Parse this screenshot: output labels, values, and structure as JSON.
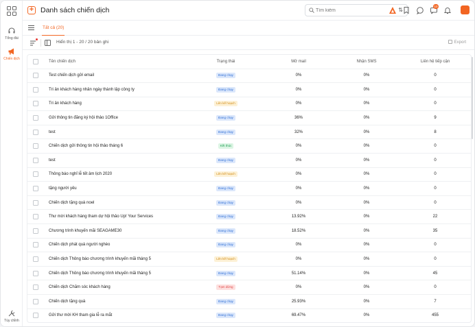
{
  "rail": {
    "items": [
      {
        "label": "Tổng đài",
        "icon": "headset-icon"
      },
      {
        "label": "Chiến dịch",
        "icon": "megaphone-icon",
        "active": true
      },
      {
        "label": "Tùy chỉnh",
        "icon": "tools-icon"
      }
    ]
  },
  "header": {
    "title": "Danh sách chiến dịch",
    "search_placeholder": "Tìm kiếm",
    "notification_count": "10"
  },
  "tabs": [
    {
      "label": "Tất cả (20)",
      "active": true
    }
  ],
  "toolbar": {
    "showing": "Hiển thị 1 - 20 / 20 bản ghi",
    "export_label": "Export"
  },
  "table": {
    "columns": [
      "Tên chiến dịch",
      "Trạng thái",
      "Mở mail",
      "Nhận SMS",
      "Liên hệ tiếp cận"
    ],
    "rows": [
      {
        "name": "Test chiến dịch gửi email",
        "status": "Đang chạy",
        "status_type": "running",
        "open": "0%",
        "sms": "0%",
        "contact": "0"
      },
      {
        "name": "Tri ân khách hàng nhân ngày thành lập công ty",
        "status": "Đang chạy",
        "status_type": "running",
        "open": "0%",
        "sms": "0%",
        "contact": "0"
      },
      {
        "name": "Tri ân khách hàng",
        "status": "Lên kế hoạch",
        "status_type": "planned",
        "open": "0%",
        "sms": "0%",
        "contact": "0"
      },
      {
        "name": "Gửi thông tin đăng ký hội thảo 1Office",
        "status": "Đang chạy",
        "status_type": "running",
        "open": "36%",
        "sms": "0%",
        "contact": "9"
      },
      {
        "name": "test",
        "status": "Đang chạy",
        "status_type": "running",
        "open": "32%",
        "sms": "0%",
        "contact": "8"
      },
      {
        "name": "Chiến dịch gửi thông tin hội thảo tháng 6",
        "status": "Kết thúc",
        "status_type": "done",
        "open": "0%",
        "sms": "0%",
        "contact": "0"
      },
      {
        "name": "test",
        "status": "Đang chạy",
        "status_type": "running",
        "open": "0%",
        "sms": "0%",
        "contact": "0"
      },
      {
        "name": "Thông báo nghỉ lễ tết âm lịch 2020",
        "status": "Lên kế hoạch",
        "status_type": "planned",
        "open": "0%",
        "sms": "0%",
        "contact": "0"
      },
      {
        "name": "tặng người yêu",
        "status": "Đang chạy",
        "status_type": "running",
        "open": "0%",
        "sms": "0%",
        "contact": "0"
      },
      {
        "name": "Chiến dịch tặng quà noel",
        "status": "Đang chạy",
        "status_type": "running",
        "open": "0%",
        "sms": "0%",
        "contact": "0"
      },
      {
        "name": "Thư mời khách hàng tham dự hội thảo Up! Your Services",
        "status": "Đang chạy",
        "status_type": "running",
        "open": "13.92%",
        "sms": "0%",
        "contact": "22"
      },
      {
        "name": "Chương trình khuyến mãi SEAGAME30",
        "status": "Đang chạy",
        "status_type": "running",
        "open": "18.52%",
        "sms": "0%",
        "contact": "35"
      },
      {
        "name": "Chiến dịch phát quà người nghèo",
        "status": "Đang chạy",
        "status_type": "running",
        "open": "0%",
        "sms": "0%",
        "contact": "0"
      },
      {
        "name": "Chiến dịch Thông báo chương trình khuyến mãi tháng 5",
        "status": "Lên kế hoạch",
        "status_type": "planned",
        "open": "0%",
        "sms": "0%",
        "contact": "0"
      },
      {
        "name": "Chiến dịch Thông báo chương trình khuyến mãi tháng 5",
        "status": "Đang chạy",
        "status_type": "running",
        "open": "51.14%",
        "sms": "0%",
        "contact": "45"
      },
      {
        "name": "Chiến dịch Chăm sóc khách hàng",
        "status": "Tạm dừng",
        "status_type": "paused",
        "open": "0%",
        "sms": "0%",
        "contact": "0"
      },
      {
        "name": "Chiến dịch tặng quà",
        "status": "Đang chạy",
        "status_type": "running",
        "open": "25.93%",
        "sms": "0%",
        "contact": "7"
      },
      {
        "name": "Gửi thư mời KH tham gia lễ ra mắt",
        "status": "Đang chạy",
        "status_type": "running",
        "open": "69.47%",
        "sms": "0%",
        "contact": "455"
      }
    ]
  },
  "colors": {
    "accent": "#f26522",
    "running": "#2f6fd6",
    "planned": "#d18a13",
    "done": "#22a056",
    "paused": "#e14646"
  }
}
